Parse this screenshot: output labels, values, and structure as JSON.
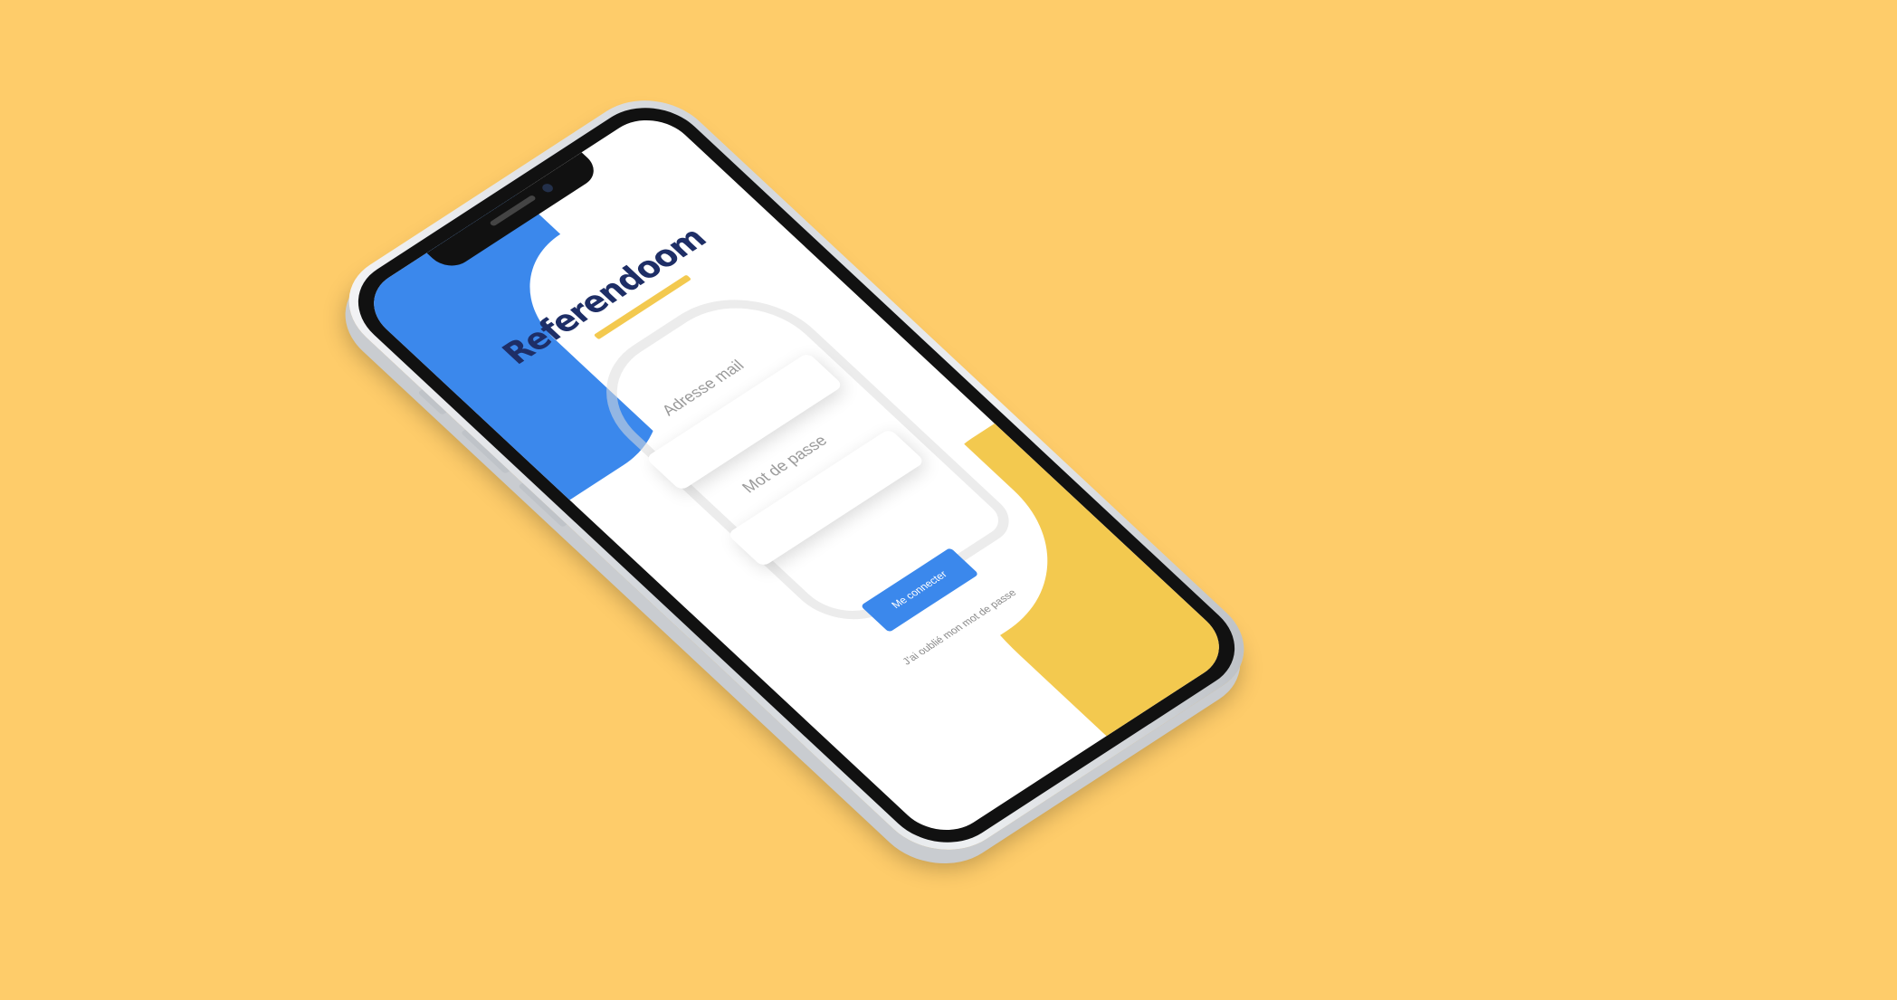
{
  "background_color": "#FECC6A",
  "app": {
    "name": "Referendoom",
    "brand_color": "#1E2E66",
    "accent_blue": "#3B88EC",
    "accent_yellow": "#F3C94F"
  },
  "login": {
    "email_label": "Adresse mail",
    "email_value": "",
    "password_label": "Mot de passe",
    "password_value": "",
    "submit_label": "Me connecter",
    "forgot_label": "J'ai oublié mon mot de passe"
  },
  "icons": {
    "background_illustration": "map-illustration-icon",
    "notch": "notch-icon"
  }
}
